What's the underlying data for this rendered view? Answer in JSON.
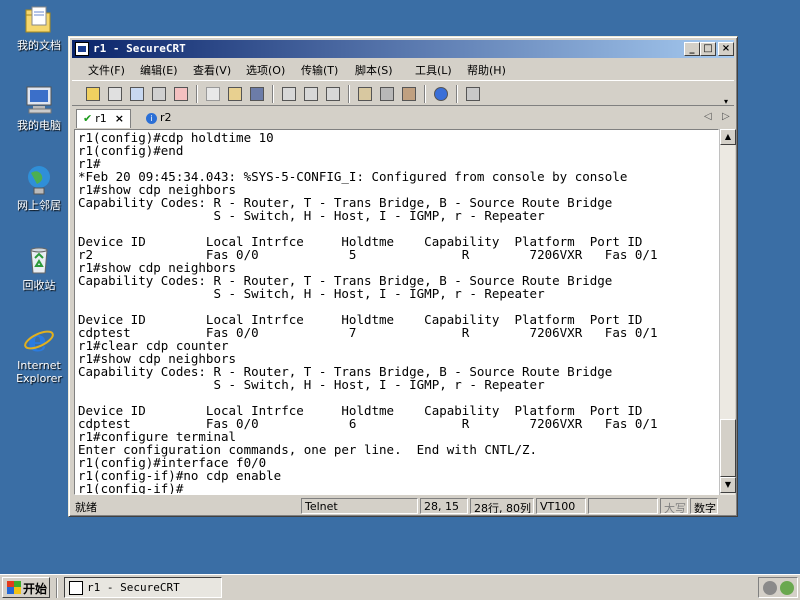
{
  "desktop": {
    "icons": [
      {
        "label": "我的文档",
        "icon": "folder-documents-icon"
      },
      {
        "label": "我的电脑",
        "icon": "computer-icon"
      },
      {
        "label": "网上邻居",
        "icon": "network-icon"
      },
      {
        "label": "回收站",
        "icon": "recycle-bin-icon"
      },
      {
        "label": "Internet Explorer",
        "icon": "internet-explorer-icon"
      }
    ]
  },
  "window": {
    "title": "r1 - SecureCRT",
    "menu": [
      "文件(F)",
      "编辑(E)",
      "查看(V)",
      "选项(O)",
      "传输(T)",
      "脚本(S)",
      "工具(L)",
      "帮助(H)"
    ],
    "tabs": [
      {
        "label": "r1",
        "state": "connected",
        "active": true
      },
      {
        "label": "r2",
        "state": "info",
        "active": false
      }
    ]
  },
  "terminal": {
    "lines": [
      "r1(config)#cdp holdtime 10",
      "r1(config)#end",
      "r1#",
      "*Feb 20 09:45:34.043: %SYS-5-CONFIG_I: Configured from console by console",
      "r1#show cdp neighbors",
      "Capability Codes: R - Router, T - Trans Bridge, B - Source Route Bridge",
      "                  S - Switch, H - Host, I - IGMP, r - Repeater",
      "",
      "Device ID        Local Intrfce     Holdtme    Capability  Platform  Port ID",
      "r2               Fas 0/0            5              R        7206VXR   Fas 0/1",
      "r1#show cdp neighbors",
      "Capability Codes: R - Router, T - Trans Bridge, B - Source Route Bridge",
      "                  S - Switch, H - Host, I - IGMP, r - Repeater",
      "",
      "Device ID        Local Intrfce     Holdtme    Capability  Platform  Port ID",
      "cdptest          Fas 0/0            7              R        7206VXR   Fas 0/1",
      "r1#clear cdp counter",
      "r1#show cdp neighbors",
      "Capability Codes: R - Router, T - Trans Bridge, B - Source Route Bridge",
      "                  S - Switch, H - Host, I - IGMP, r - Repeater",
      "",
      "Device ID        Local Intrfce     Holdtme    Capability  Platform  Port ID",
      "cdptest          Fas 0/0            6              R        7206VXR   Fas 0/1",
      "r1#configure terminal",
      "Enter configuration commands, one per line.  End with CNTL/Z.",
      "r1(config)#interface f0/0",
      "r1(config-if)#no cdp enable",
      "r1(config-if)#"
    ]
  },
  "status": {
    "ready": "就绪",
    "protocol": "Telnet",
    "cursor": "28, 15",
    "size": "28行, 80列",
    "emulation": "VT100",
    "blank": "",
    "caps": "大写",
    "num": "数字"
  },
  "taskbar": {
    "start": "开始",
    "task": "r1 - SecureCRT"
  }
}
